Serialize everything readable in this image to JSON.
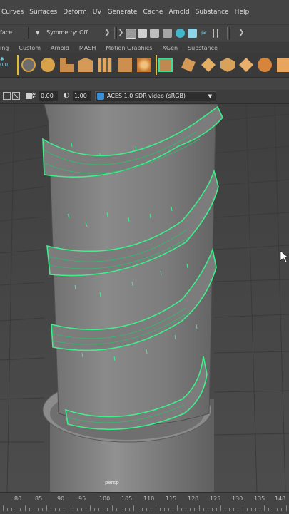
{
  "menubar": {
    "items": [
      "Curves",
      "Surfaces",
      "Deform",
      "UV",
      "Generate",
      "Cache",
      "Arnold",
      "Substance",
      "Help"
    ]
  },
  "statusline": {
    "mode_value": "face",
    "symmetry": "Symmetry: Off"
  },
  "shelf": {
    "tabs": [
      "ing",
      "Custom",
      "Arnold",
      "MASH",
      "Motion Graphics",
      "XGen",
      "Substance"
    ]
  },
  "panel_toolbar": {
    "exposure": "0.00",
    "gamma": "1.00",
    "color_space": "ACES 1.0 SDR-video (sRGB)"
  },
  "viewport": {
    "camera": "persp"
  },
  "timeslider": {
    "ticks": [
      "80",
      "85",
      "90",
      "95",
      "100",
      "105",
      "110",
      "115",
      "120",
      "125",
      "130",
      "135",
      "140"
    ]
  },
  "colors": {
    "selection_wire": "#3cf08a",
    "background": "#444444",
    "mesh_gray": "#8a8a8a"
  }
}
